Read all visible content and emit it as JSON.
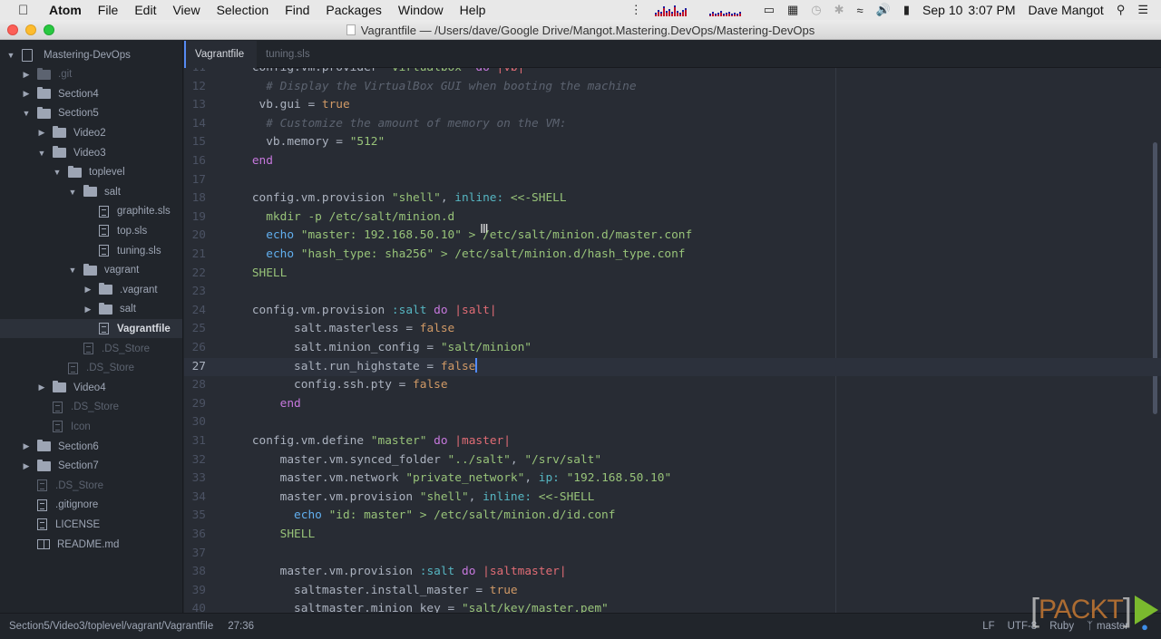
{
  "menubar": {
    "app": "Atom",
    "items": [
      "File",
      "Edit",
      "View",
      "Selection",
      "Find",
      "Packages",
      "Window",
      "Help"
    ],
    "date": "Sep 10",
    "time": "3:07 PM",
    "user": "Dave Mangot"
  },
  "window": {
    "title": "Vagrantfile — /Users/dave/Google Drive/Mangot.Mastering.DevOps/Mastering-DevOps"
  },
  "tree": {
    "root": "Mastering-DevOps",
    "rows": [
      {
        "label": ".git",
        "type": "folder",
        "expanded": false,
        "dim": true
      },
      {
        "label": "Section4",
        "type": "folder",
        "expanded": false
      },
      {
        "label": "Section5",
        "type": "folder",
        "expanded": true
      },
      {
        "label": "Video2",
        "type": "folder",
        "expanded": false
      },
      {
        "label": "Video3",
        "type": "folder",
        "expanded": true
      },
      {
        "label": "toplevel",
        "type": "folder",
        "expanded": true
      },
      {
        "label": "salt",
        "type": "folder",
        "expanded": true
      },
      {
        "label": "graphite.sls",
        "type": "file"
      },
      {
        "label": "top.sls",
        "type": "file"
      },
      {
        "label": "tuning.sls",
        "type": "file"
      },
      {
        "label": "vagrant",
        "type": "folder",
        "expanded": true
      },
      {
        "label": ".vagrant",
        "type": "folder",
        "expanded": false
      },
      {
        "label": "salt",
        "type": "folder",
        "expanded": false
      },
      {
        "label": "Vagrantfile",
        "type": "file",
        "selected": true
      },
      {
        "label": ".DS_Store",
        "type": "file",
        "dim": true
      },
      {
        "label": ".DS_Store",
        "type": "file",
        "dim": true
      },
      {
        "label": "Video4",
        "type": "folder",
        "expanded": false
      },
      {
        "label": ".DS_Store",
        "type": "file",
        "dim": true
      },
      {
        "label": "Icon",
        "type": "file",
        "dim": true
      },
      {
        "label": "Section6",
        "type": "folder",
        "expanded": false
      },
      {
        "label": "Section7",
        "type": "folder",
        "expanded": false
      },
      {
        "label": ".DS_Store",
        "type": "file",
        "dim": true
      },
      {
        "label": ".gitignore",
        "type": "file"
      },
      {
        "label": "LICENSE",
        "type": "file"
      },
      {
        "label": "README.md",
        "type": "book"
      }
    ]
  },
  "tabs": [
    {
      "label": "Vagrantfile",
      "active": true
    },
    {
      "label": "tuning.sls",
      "active": false
    }
  ],
  "editor": {
    "cursor_line": 27,
    "lines": [
      {
        "n": "11",
        "tokens": [
          [
            "    config.vm.provider ",
            ""
          ],
          [
            "\"virtualbox\"",
            "str"
          ],
          [
            " ",
            ""
          ],
          [
            "do",
            "kw"
          ],
          [
            " ",
            ""
          ],
          [
            "|vb|",
            "var"
          ]
        ]
      },
      {
        "n": "12",
        "tokens": [
          [
            "      ",
            ""
          ],
          [
            "# Display the VirtualBox GUI when booting the machine",
            "com"
          ]
        ]
      },
      {
        "n": "13",
        "tokens": [
          [
            "     vb.gui = ",
            ""
          ],
          [
            "true",
            "con"
          ]
        ]
      },
      {
        "n": "14",
        "tokens": [
          [
            "      ",
            ""
          ],
          [
            "# Customize the amount of memory on the VM:",
            "com"
          ]
        ]
      },
      {
        "n": "15",
        "tokens": [
          [
            "      vb.memory = ",
            ""
          ],
          [
            "\"512\"",
            "str"
          ]
        ]
      },
      {
        "n": "16",
        "tokens": [
          [
            "    ",
            ""
          ],
          [
            "end",
            "kw"
          ]
        ]
      },
      {
        "n": "17",
        "tokens": []
      },
      {
        "n": "18",
        "tokens": [
          [
            "    config.vm.provision ",
            ""
          ],
          [
            "\"shell\"",
            "str"
          ],
          [
            ", ",
            ""
          ],
          [
            "inline:",
            "sym"
          ],
          [
            " ",
            ""
          ],
          [
            "<<-SHELL",
            "str"
          ]
        ]
      },
      {
        "n": "19",
        "tokens": [
          [
            "      mkdir -p /etc/salt/minion.d",
            "str"
          ]
        ]
      },
      {
        "n": "20",
        "tokens": [
          [
            "      ",
            ""
          ],
          [
            "echo",
            "fn"
          ],
          [
            " \"master: 192.168.50.10\" > /etc/salt/minion.d/master.conf",
            "str"
          ]
        ]
      },
      {
        "n": "21",
        "tokens": [
          [
            "      ",
            ""
          ],
          [
            "echo",
            "fn"
          ],
          [
            " \"hash_type: sha256\" > /etc/salt/minion.d/hash_type.conf",
            "str"
          ]
        ]
      },
      {
        "n": "22",
        "tokens": [
          [
            "    SHELL",
            "str"
          ]
        ]
      },
      {
        "n": "23",
        "tokens": []
      },
      {
        "n": "24",
        "tokens": [
          [
            "    config.vm.provision ",
            ""
          ],
          [
            ":salt",
            "sym"
          ],
          [
            " ",
            ""
          ],
          [
            "do",
            "kw"
          ],
          [
            " ",
            ""
          ],
          [
            "|salt|",
            "var"
          ]
        ]
      },
      {
        "n": "25",
        "tokens": [
          [
            "          salt.masterless = ",
            ""
          ],
          [
            "false",
            "con"
          ]
        ]
      },
      {
        "n": "26",
        "tokens": [
          [
            "          salt.minion_config = ",
            ""
          ],
          [
            "\"salt/minion\"",
            "str"
          ]
        ]
      },
      {
        "n": "27",
        "tokens": [
          [
            "          salt.run_highstate = ",
            ""
          ],
          [
            "false",
            "con"
          ]
        ]
      },
      {
        "n": "28",
        "tokens": [
          [
            "          config.ssh.pty = ",
            ""
          ],
          [
            "false",
            "con"
          ]
        ]
      },
      {
        "n": "29",
        "tokens": [
          [
            "        ",
            ""
          ],
          [
            "end",
            "kw"
          ]
        ]
      },
      {
        "n": "30",
        "tokens": []
      },
      {
        "n": "31",
        "tokens": [
          [
            "    config.vm.define ",
            ""
          ],
          [
            "\"master\"",
            "str"
          ],
          [
            " ",
            ""
          ],
          [
            "do",
            "kw"
          ],
          [
            " ",
            ""
          ],
          [
            "|master|",
            "var"
          ]
        ]
      },
      {
        "n": "32",
        "tokens": [
          [
            "        master.vm.synced_folder ",
            ""
          ],
          [
            "\"../salt\"",
            "str"
          ],
          [
            ", ",
            ""
          ],
          [
            "\"/srv/salt\"",
            "str"
          ]
        ]
      },
      {
        "n": "33",
        "tokens": [
          [
            "        master.vm.network ",
            ""
          ],
          [
            "\"private_network\"",
            "str"
          ],
          [
            ", ",
            ""
          ],
          [
            "ip:",
            "sym"
          ],
          [
            " ",
            ""
          ],
          [
            "\"192.168.50.10\"",
            "str"
          ]
        ]
      },
      {
        "n": "34",
        "tokens": [
          [
            "        master.vm.provision ",
            ""
          ],
          [
            "\"shell\"",
            "str"
          ],
          [
            ", ",
            ""
          ],
          [
            "inline:",
            "sym"
          ],
          [
            " ",
            ""
          ],
          [
            "<<-SHELL",
            "str"
          ]
        ]
      },
      {
        "n": "35",
        "tokens": [
          [
            "          ",
            ""
          ],
          [
            "echo",
            "fn"
          ],
          [
            " \"id: master\" > /etc/salt/minion.d/id.conf",
            "str"
          ]
        ]
      },
      {
        "n": "36",
        "tokens": [
          [
            "        SHELL",
            "str"
          ]
        ]
      },
      {
        "n": "37",
        "tokens": []
      },
      {
        "n": "38",
        "tokens": [
          [
            "        master.vm.provision ",
            ""
          ],
          [
            ":salt",
            "sym"
          ],
          [
            " ",
            ""
          ],
          [
            "do",
            "kw"
          ],
          [
            " ",
            ""
          ],
          [
            "|saltmaster|",
            "var"
          ]
        ]
      },
      {
        "n": "39",
        "tokens": [
          [
            "          saltmaster.install_master = ",
            ""
          ],
          [
            "true",
            "con"
          ]
        ]
      },
      {
        "n": "40",
        "tokens": [
          [
            "          saltmaster.minion_key = ",
            ""
          ],
          [
            "\"salt/key/master.pem\"",
            "str"
          ]
        ]
      }
    ]
  },
  "statusbar": {
    "path": "Section5/Video3/toplevel/vagrant/Vagrantfile",
    "position": "27:36",
    "line_ending": "LF",
    "encoding": "UTF-8",
    "grammar": "Ruby",
    "branch": "master"
  },
  "watermark": {
    "text": "PACKT"
  }
}
